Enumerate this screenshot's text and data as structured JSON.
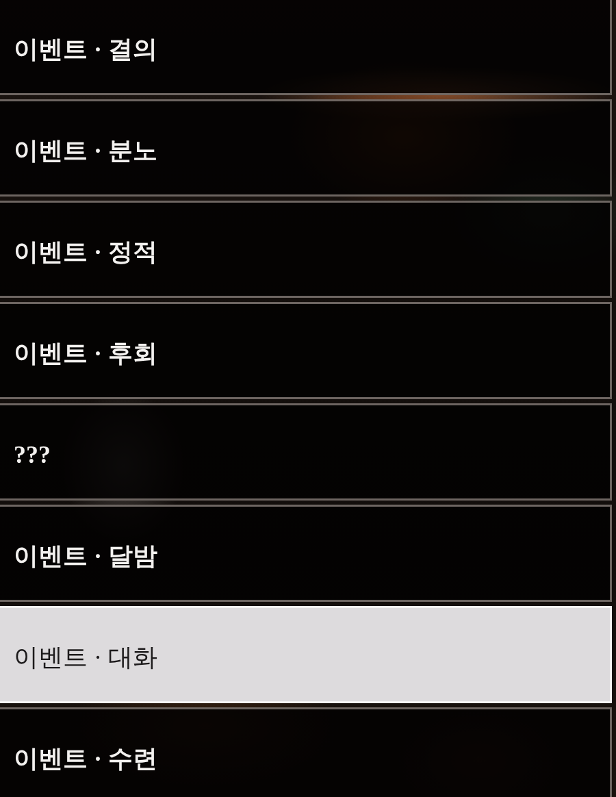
{
  "items": [
    {
      "label": "이벤트 · 결의",
      "selected": false
    },
    {
      "label": "이벤트 · 분노",
      "selected": false
    },
    {
      "label": "이벤트 · 정적",
      "selected": false
    },
    {
      "label": "이벤트 · 후회",
      "selected": false
    },
    {
      "label": "???",
      "selected": false
    },
    {
      "label": "이벤트 · 달밤",
      "selected": false
    },
    {
      "label": "이벤트 · 대화",
      "selected": true
    },
    {
      "label": "이벤트 · 수련",
      "selected": false
    }
  ]
}
